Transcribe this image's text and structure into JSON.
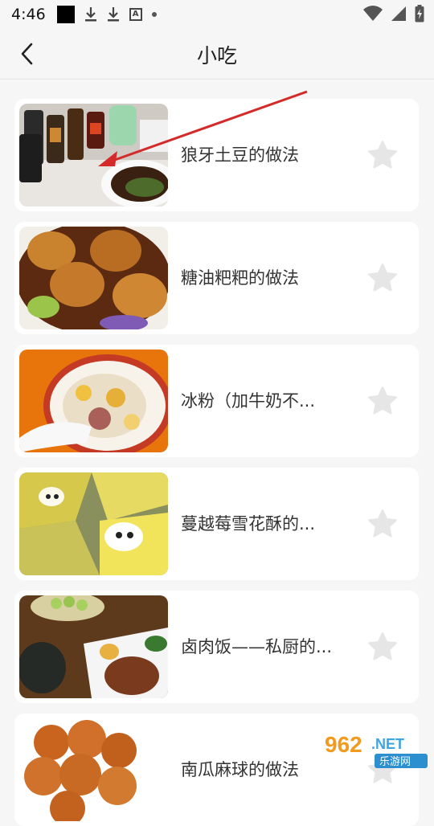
{
  "status_bar": {
    "time": "4:46"
  },
  "header": {
    "title": "小吃"
  },
  "items": [
    {
      "title": "狼牙土豆的做法"
    },
    {
      "title": "糖油粑粑的做法"
    },
    {
      "title": "冰粉（加牛奶不..."
    },
    {
      "title": "蔓越莓雪花酥的..."
    },
    {
      "title": "卤肉饭——私厨的..."
    },
    {
      "title": "南瓜麻球的做法"
    }
  ],
  "watermark": {
    "brand": "962.NET",
    "sub": "乐游网"
  },
  "colors": {
    "background": "#f6f6f6",
    "card": "#ffffff",
    "star": "#e6e6e6",
    "annotation_arrow": "#d42a2a"
  }
}
